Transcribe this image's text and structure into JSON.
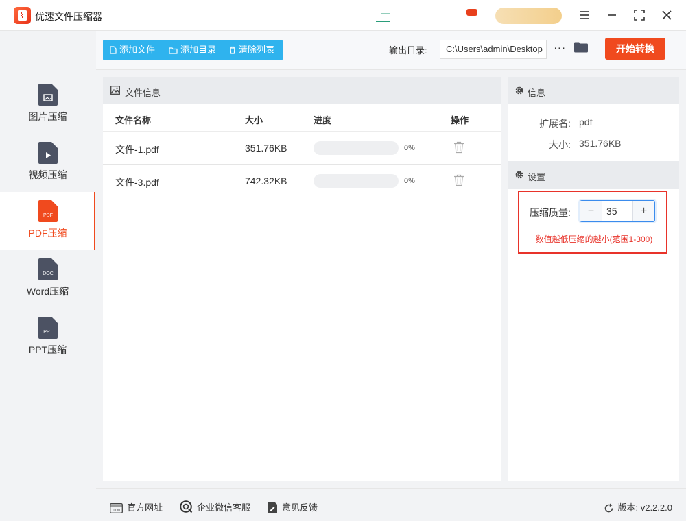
{
  "app": {
    "title": "优速文件压缩器"
  },
  "sidebar": {
    "items": [
      {
        "label": "图片压缩",
        "icon": "image-file-icon",
        "tag": ""
      },
      {
        "label": "视频压缩",
        "icon": "video-file-icon",
        "tag": ""
      },
      {
        "label": "PDF压缩",
        "icon": "pdf-file-icon",
        "tag": "PDF",
        "active": true
      },
      {
        "label": "Word压缩",
        "icon": "doc-file-icon",
        "tag": "DOC"
      },
      {
        "label": "PPT压缩",
        "icon": "ppt-file-icon",
        "tag": "PPT"
      }
    ]
  },
  "toolbar": {
    "add_file": "添加文件",
    "add_folder": "添加目录",
    "clear_list": "清除列表",
    "output_label": "输出目录:",
    "output_path": "C:\\Users\\admin\\Desktop",
    "more": "···",
    "start": "开始转换"
  },
  "file_panel": {
    "title": "文件信息",
    "columns": {
      "name": "文件名称",
      "size": "大小",
      "progress": "进度",
      "action": "操作"
    },
    "rows": [
      {
        "name": "文件-1.pdf",
        "size": "351.76KB",
        "progress": 0,
        "progress_text": "0%"
      },
      {
        "name": "文件-3.pdf",
        "size": "742.32KB",
        "progress": 0,
        "progress_text": "0%"
      }
    ]
  },
  "info": {
    "title": "信息",
    "ext_label": "扩展名:",
    "ext_value": "pdf",
    "size_label": "大小:",
    "size_value": "351.76KB"
  },
  "settings": {
    "title": "设置",
    "quality_label": "压缩质量:",
    "quality_value": "35",
    "minus": "−",
    "plus": "+",
    "hint": "数值越低压缩的越小(范围1-300)"
  },
  "footer": {
    "website": "官方网址",
    "wechat": "企业微信客服",
    "feedback": "意见反馈",
    "version": "版本: v2.2.2.0"
  },
  "colors": {
    "accent": "#f04a1e",
    "primary": "#2fb3ee",
    "highlight": "#e8332a"
  }
}
